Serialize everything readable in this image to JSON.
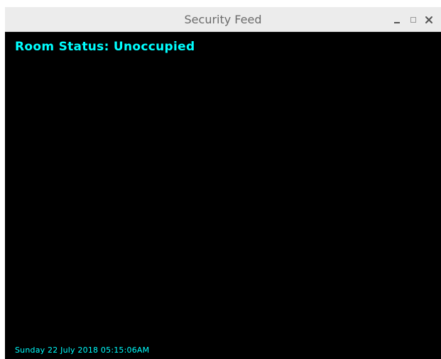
{
  "window": {
    "title": "Security Feed",
    "controls": {
      "minimize_icon": "minimize-icon",
      "maximize_icon": "maximize-icon",
      "close_icon": "close-icon"
    }
  },
  "feed": {
    "status_text": "Room Status: Unoccupied",
    "timestamp": "Sunday 22 July 2018 05:15:06AM",
    "overlay_color": "#00ffff",
    "background_color": "#000000"
  }
}
